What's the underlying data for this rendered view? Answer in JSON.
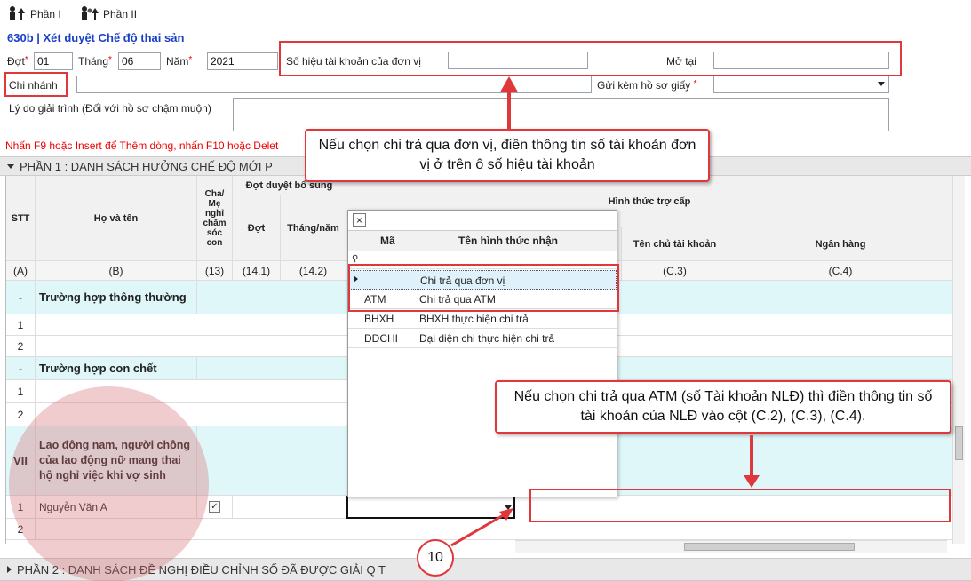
{
  "toolbar": {
    "part1_label": "Phần I",
    "part2_label": "Phần II"
  },
  "form": {
    "title": "630b | Xét duyệt Chế độ thai sản",
    "dot_label": "Đợt",
    "dot_value": "01",
    "thang_label": "Tháng",
    "thang_value": "06",
    "nam_label": "Năm",
    "nam_value": "2021",
    "account_label": "Số hiệu tài khoản của đơn vị",
    "account_value": "",
    "motai_label": "Mở tại",
    "motai_value": "",
    "branch_label": "Chi nhánh",
    "branch_value": "",
    "attach_label": "Gửi kèm hồ sơ giấy",
    "attach_value": "",
    "reason_label": "Lý do giải trình (Đối với hồ sơ chậm muộn)",
    "reason_value": "",
    "hint": "Nhấn F9 hoặc Insert để Thêm dòng, nhấn F10 hoặc Delet"
  },
  "section1": {
    "title": "PHẦN 1 :  DANH SÁCH HƯỞNG CHẾ ĐỘ MỚI P"
  },
  "section2": {
    "title": "PHẦN 2 : DANH SÁCH ĐỀ NGHỊ ĐIỀU CHỈNH SỐ ĐÃ ĐƯỢC GIẢI Q   T"
  },
  "grid": {
    "headers": {
      "stt": "STT",
      "name": "Họ và tên",
      "parent_leave": "Cha/ Mẹ nghỉ chăm sóc con",
      "supplement": "Đợt duyệt bổ sung",
      "dot": "Đợt",
      "month_year": "Tháng/năm",
      "allowance_form": "Hình thức trợ cấp",
      "holder": "Tên chủ tài khoản",
      "bank": "Ngân hàng"
    },
    "codes": {
      "a": "(A)",
      "b": "(B)",
      "c13": "(13)",
      "c141": "(14.1)",
      "c142": "(14.2)",
      "c3": "(C.3)",
      "c4": "(C.4)"
    },
    "rows": [
      {
        "stt": "-",
        "name": "Trường hợp thông thường"
      },
      {
        "stt": "1",
        "name": ""
      },
      {
        "stt": "2",
        "name": ""
      },
      {
        "stt": "-",
        "name": "Trường hợp con chết"
      },
      {
        "stt": "1",
        "name": ""
      },
      {
        "stt": "2",
        "name": ""
      },
      {
        "stt": "VII",
        "name": "Lao động nam, người chồng của lao động nữ mang thai hộ nghỉ việc khi vợ sinh"
      },
      {
        "stt": "1",
        "name": "Nguyễn Văn A",
        "checked": "✓"
      },
      {
        "stt": "2",
        "name": ""
      }
    ]
  },
  "popup": {
    "close": "×",
    "col_code": "Mã",
    "col_name": "Tên hình thức nhận",
    "filter_icon": "⚲",
    "items": [
      {
        "code": "",
        "name": "Chi trả qua đơn vị"
      },
      {
        "code": "ATM",
        "name": "Chi trả qua ATM"
      },
      {
        "code": "BHXH",
        "name": "BHXH thực hiện chi trả"
      },
      {
        "code": "DDCHI",
        "name": "Đại diện chi thực hiện chi trả"
      }
    ]
  },
  "callouts": {
    "top": "Nếu chọn chi trả qua đơn vị, điền thông tin số tài khoản đơn vị ở trên ô số hiệu tài khoản",
    "right": "Nếu chọn chi trả qua ATM (số Tài khoản NLĐ) thì điền thông tin số tài khoản của NLĐ vào cột (C.2), (C.3), (C.4).",
    "badge": "10"
  },
  "colors": {
    "accent_red": "#e0373a",
    "title_blue": "#1a3fc8",
    "row_cyan": "#dff7f9"
  }
}
